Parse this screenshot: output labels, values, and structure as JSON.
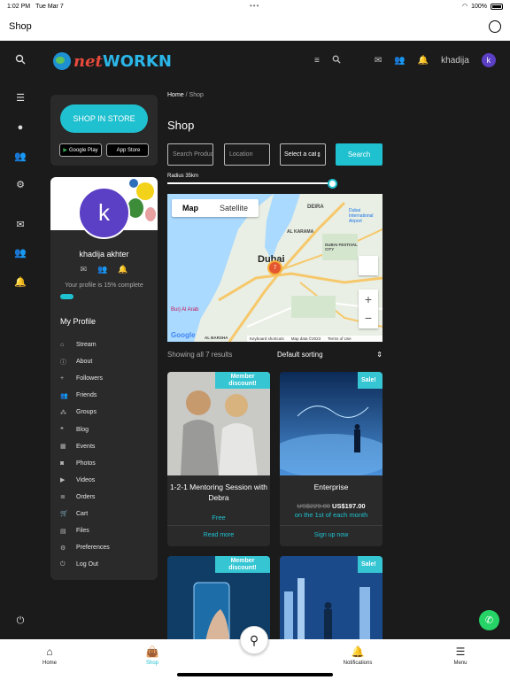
{
  "statusbar": {
    "time": "1:02 PM",
    "date": "Tue Mar 7",
    "battery": "100%"
  },
  "appbar": {
    "title": "Shop",
    "palette_icon": "palette-icon"
  },
  "header": {
    "logo_net": "net",
    "logo_workn": "WORKN",
    "username": "khadija",
    "avatar_letter": "k"
  },
  "store": {
    "shop_in_store": "SHOP IN STORE",
    "google_play": "Google Play",
    "app_store": "App Store"
  },
  "profile": {
    "avatar_letter": "k",
    "name": "khadija akhter",
    "complete_text": "Your profile is 15% complete",
    "complete_fraction": 0.15,
    "my_profile": "My Profile",
    "menu": [
      {
        "label": "Stream",
        "icon": "home-icon"
      },
      {
        "label": "About",
        "icon": "info-icon"
      },
      {
        "label": "Followers",
        "icon": "user-plus-icon"
      },
      {
        "label": "Friends",
        "icon": "users-icon"
      },
      {
        "label": "Groups",
        "icon": "group-icon"
      },
      {
        "label": "Blog",
        "icon": "quote-icon"
      },
      {
        "label": "Events",
        "icon": "calendar-icon"
      },
      {
        "label": "Photos",
        "icon": "camera-icon"
      },
      {
        "label": "Videos",
        "icon": "video-icon"
      },
      {
        "label": "Orders",
        "icon": "list-icon"
      },
      {
        "label": "Cart",
        "icon": "cart-icon"
      },
      {
        "label": "Files",
        "icon": "file-icon"
      },
      {
        "label": "Preferences",
        "icon": "gear-icon"
      },
      {
        "label": "Log Out",
        "icon": "power-icon"
      }
    ]
  },
  "main": {
    "breadcrumb_home": "Home",
    "breadcrumb_sep": " / ",
    "breadcrumb_current": "Shop",
    "title": "Shop",
    "search_placeholder": "Search Products",
    "location_placeholder": "Location",
    "category_value": "Select a category",
    "search_button": "Search",
    "radius_label": "Radius 35km",
    "map": {
      "tab_map": "Map",
      "tab_satellite": "Satellite",
      "marker_count": "7",
      "city_label": "Dubai",
      "labels": [
        "DEIRA",
        "AL KARAMA",
        "Dubai International Airport",
        "Burj Al Arab",
        "AL BARSHA",
        "DUBAI FESTIVAL CITY"
      ],
      "footer_shortcuts": "Keyboard shortcuts",
      "footer_data": "Map data ©2023",
      "footer_terms": "Terms of Use",
      "google": "Google"
    },
    "showing": "Showing all 7 results",
    "sorting": "Default sorting"
  },
  "products": [
    {
      "ribbon": "Member discount!",
      "title": "1-2-1 Mentoring Session with Debra",
      "price": "Free",
      "action": "Read more"
    },
    {
      "ribbon": "Sale!",
      "title": "Enterprise",
      "old_price": "US$229.00",
      "new_price": "US$197.00",
      "price_note": "on the 1st of each month",
      "action": "Sign up now"
    },
    {
      "ribbon": "Member discount!"
    },
    {
      "ribbon": "Sale!"
    }
  ],
  "tabbar": {
    "home": "Home",
    "shop": "Shop",
    "notifications": "Notifications",
    "menu": "Menu"
  },
  "colors": {
    "accent": "#1fc0cf",
    "background": "#1b1b1b",
    "card": "#2a2a2a",
    "avatar": "#5b3fc4"
  }
}
